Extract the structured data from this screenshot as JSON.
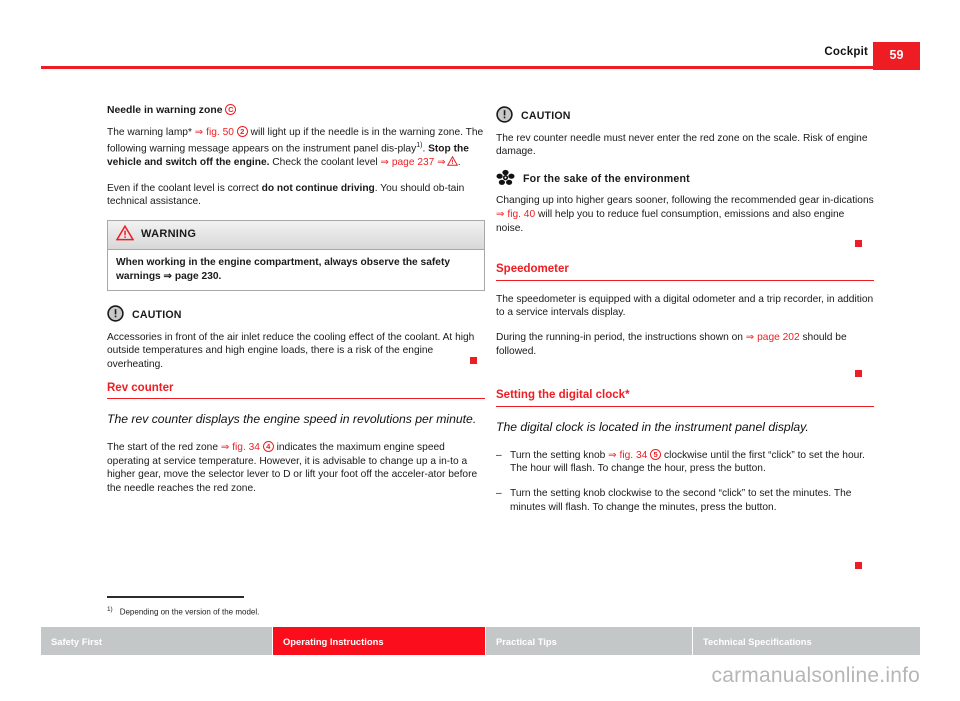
{
  "header": {
    "title": "Cockpit",
    "page_number": "59",
    "accent_color": "#ee1d23"
  },
  "left_column": {
    "subhead": "Needle in warning zone",
    "subhead_callout": "C",
    "para1": {
      "t1": "The warning lamp* ",
      "xref": "⇒ fig. 50",
      "callout": "2",
      "t2": " will light up if the needle is in the warning zone. The following warning message appears on the instrument panel dis-play",
      "footnote_ref": "1)",
      "t3": ". ",
      "bold": "Stop the vehicle and switch off the engine.",
      "t4": " Check the coolant level ",
      "xref2": "⇒ page 237",
      "t5": " ⇒",
      "t6": "."
    },
    "para2": {
      "t1": "Even if the coolant level is correct ",
      "bold": "do not continue driving",
      "t2": ". You should ob-tain technical assistance."
    },
    "warning_box": {
      "title": "WARNING",
      "body": "When working in the engine compartment, always observe the safety warnings ⇒ page 230."
    },
    "caution": {
      "title": "CAUTION",
      "body": "Accessories in front of the air inlet reduce the cooling effect of the coolant. At high outside temperatures and high engine loads, there is a risk of the engine overheating."
    },
    "rev_counter": {
      "heading": "Rev counter",
      "lead": "The rev counter displays the engine speed in revolutions per minute.",
      "para": {
        "t1": "The start of the red zone ",
        "xref": "⇒ fig. 34",
        "callout": "4",
        "t2": " indicates the maximum engine speed operating at service temperature. However, it is advisable to change up a in-to a higher gear, move the selector lever to D or lift your foot off the acceler-ator before the needle reaches the red zone."
      }
    }
  },
  "right_column": {
    "caution": {
      "title": "CAUTION",
      "body": "The rev counter needle must never enter the red zone on the scale. Risk of engine damage."
    },
    "environment": {
      "title": "For the sake of the environment",
      "t1": "Changing up into higher gears sooner, following the recommended gear in-dications ",
      "xref": "⇒ fig. 40",
      "t2": " will help you to reduce fuel consumption, emissions and also engine noise."
    },
    "speedometer": {
      "heading": "Speedometer",
      "para1": "The speedometer is equipped with a digital odometer and a trip recorder, in addition to a service intervals display.",
      "para2": {
        "t1": "During the running-in period, the instructions shown on ",
        "xref": "⇒ page 202",
        "t2": " should be followed."
      }
    },
    "digital_clock": {
      "heading": "Setting the digital clock*",
      "lead": "The digital clock is located in the instrument panel display.",
      "items": [
        {
          "mark": "–",
          "t1": "Turn the setting knob ",
          "xref": "⇒ fig. 34",
          "callout": "5",
          "t2": " clockwise until the first “click” to set the hour. The hour will flash. To change the hour, press the button."
        },
        {
          "mark": "–",
          "t1": "Turn the setting knob clockwise to the second “click” to set the minutes. The minutes will flash. To change the minutes, press the button.",
          "xref": "",
          "callout": "",
          "t2": ""
        }
      ]
    }
  },
  "footnote": {
    "marker": "1)",
    "text": "Depending on the version of the model."
  },
  "footer": {
    "tabs": [
      {
        "label": "Safety First",
        "active": false
      },
      {
        "label": "Operating Instructions",
        "active": true
      },
      {
        "label": "Practical Tips",
        "active": false
      },
      {
        "label": "Technical Specifications",
        "active": false
      }
    ]
  },
  "watermark": "carmanualsonline.info"
}
